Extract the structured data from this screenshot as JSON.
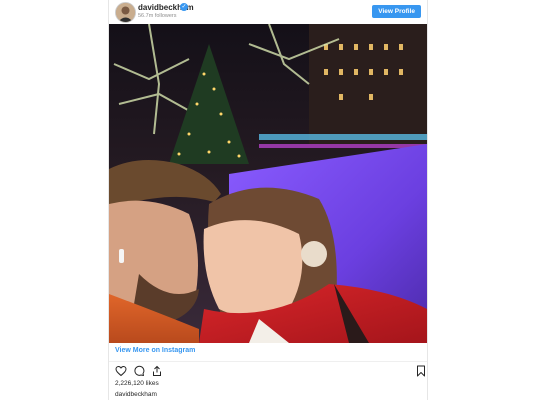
{
  "post": {
    "username": "davidbeckham",
    "followers": "56.7m followers",
    "view_profile_label": "View Profile",
    "view_more_label": "View More on Instagram",
    "likes_text": "2,226,120 likes",
    "caption_username": "davidbeckham"
  },
  "icons": [
    "verified-badge-icon",
    "heart-icon",
    "comment-icon",
    "share-icon",
    "bookmark-icon"
  ],
  "colors": {
    "accent": "#3897f0",
    "text": "#262626",
    "muted": "#8e8e8e"
  }
}
